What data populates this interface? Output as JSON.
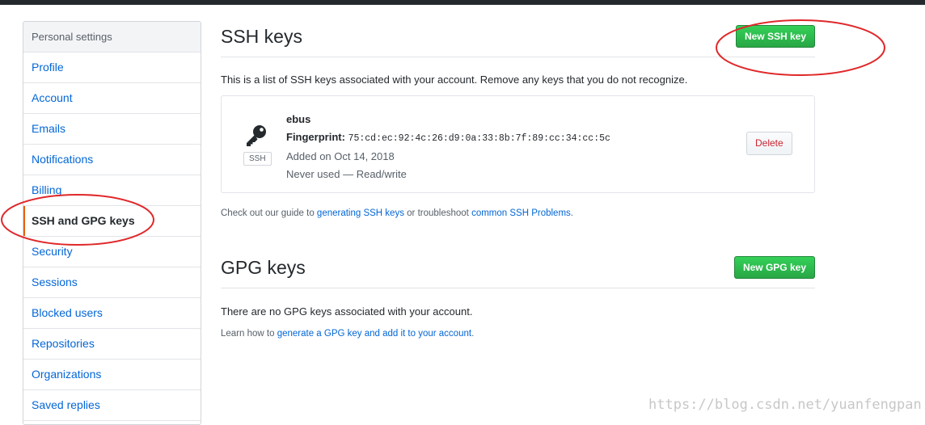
{
  "sidebar": {
    "header": "Personal settings",
    "items": [
      {
        "label": "Profile"
      },
      {
        "label": "Account"
      },
      {
        "label": "Emails"
      },
      {
        "label": "Notifications"
      },
      {
        "label": "Billing"
      },
      {
        "label": "SSH and GPG keys",
        "selected": true
      },
      {
        "label": "Security"
      },
      {
        "label": "Sessions"
      },
      {
        "label": "Blocked users"
      },
      {
        "label": "Repositories"
      },
      {
        "label": "Organizations"
      },
      {
        "label": "Saved replies"
      }
    ]
  },
  "ssh": {
    "title": "SSH keys",
    "new_button": "New SSH key",
    "intro": "This is a list of SSH keys associated with your account. Remove any keys that you do not recognize.",
    "key": {
      "icon": "key-icon",
      "badge": "SSH",
      "name": "ebus",
      "fingerprint_label": "Fingerprint:",
      "fingerprint": "75:cd:ec:92:4c:26:d9:0a:33:8b:7f:89:cc:34:cc:5c",
      "added": "Added on Oct 14, 2018",
      "usage": "Never used — Read/write",
      "delete_button": "Delete"
    },
    "guide": {
      "prefix": "Check out our guide to ",
      "link1": "generating SSH keys",
      "middle": " or troubleshoot ",
      "link2": "common SSH Problems",
      "suffix": "."
    }
  },
  "gpg": {
    "title": "GPG keys",
    "new_button": "New GPG key",
    "empty": "There are no GPG keys associated with your account.",
    "learn_prefix": "Learn how to ",
    "learn_link": "generate a GPG key and add it to your account",
    "learn_suffix": "."
  },
  "watermark": "https://blog.csdn.net/yuanfengpan",
  "colors": {
    "link": "#0366d6",
    "green": "#28a745",
    "danger": "#cb2431",
    "selected_bar": "#e36209",
    "annotation": "#e0282a"
  }
}
